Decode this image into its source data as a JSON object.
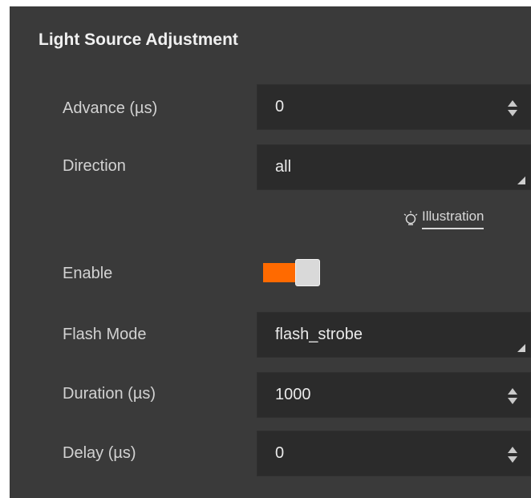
{
  "panel": {
    "title": "Light Source Adjustment"
  },
  "fields": {
    "advance": {
      "label": "Advance (µs)",
      "value": "0"
    },
    "direction": {
      "label": "Direction",
      "value": "all"
    },
    "illustration": {
      "label": "Illustration",
      "icon": "lightbulb-icon"
    },
    "enable": {
      "label": "Enable",
      "state": "on"
    },
    "flash_mode": {
      "label": "Flash Mode",
      "value": "flash_strobe"
    },
    "duration": {
      "label": "Duration (µs)",
      "value": "1000"
    },
    "delay": {
      "label": "Delay (µs)",
      "value": "0"
    }
  },
  "colors": {
    "panel_bg": "#3a3a3a",
    "field_bg": "#2b2b2b",
    "toggle_on": "#ff6a00"
  }
}
